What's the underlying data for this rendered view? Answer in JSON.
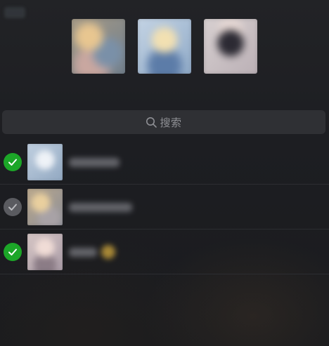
{
  "search": {
    "placeholder": "搜索",
    "icon": "search-icon"
  },
  "selected_contacts": {
    "count": 3
  },
  "contacts": [
    {
      "checked": true,
      "status_color": "#1ca628"
    },
    {
      "checked": false,
      "status_color": "#5a5b60"
    },
    {
      "checked": true,
      "status_color": "#1ca628"
    }
  ],
  "colors": {
    "background": "#1f2024",
    "search_bar": "#2f3034",
    "check_active": "#1ca628",
    "check_disabled": "#5a5b60",
    "divider": "#2c2d31"
  }
}
